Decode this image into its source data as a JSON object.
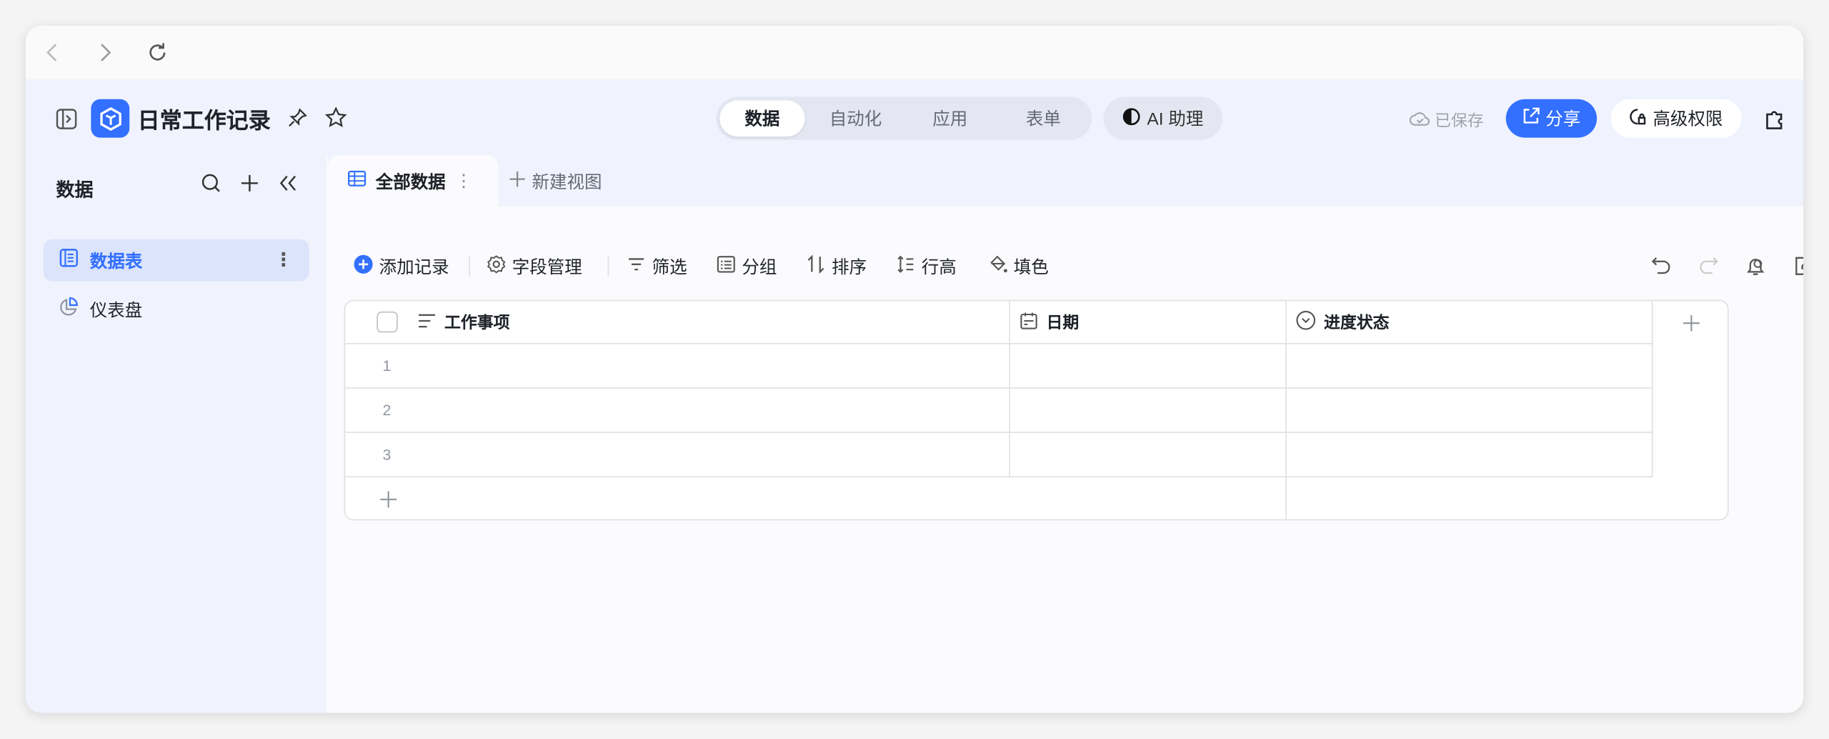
{
  "browser": {
    "back": "back-icon",
    "forward": "forward-icon",
    "reload": "reload-icon"
  },
  "header": {
    "title": "日常工作记录",
    "tabs": [
      {
        "label": "数据",
        "active": true
      },
      {
        "label": "自动化"
      },
      {
        "label": "应用"
      },
      {
        "label": "表单"
      }
    ],
    "ai_label": "AI 助理",
    "saved_label": "已保存",
    "share_label": "分享",
    "permission_label": "高级权限",
    "accent": "#3370ff"
  },
  "sidebar": {
    "title": "数据",
    "items": [
      {
        "label": "数据表",
        "selected": true
      },
      {
        "label": "仪表盘"
      }
    ]
  },
  "view_tabs": {
    "active": "全部数据",
    "new_view": "新建视图"
  },
  "toolbar": {
    "add_record": "添加记录",
    "fields": "字段管理",
    "filter": "筛选",
    "group": "分组",
    "sort": "排序",
    "row_height": "行高",
    "fill_color": "填色"
  },
  "table": {
    "columns": [
      "工作事项",
      "日期",
      "进度状态"
    ],
    "rows": [
      "1",
      "2",
      "3"
    ]
  }
}
